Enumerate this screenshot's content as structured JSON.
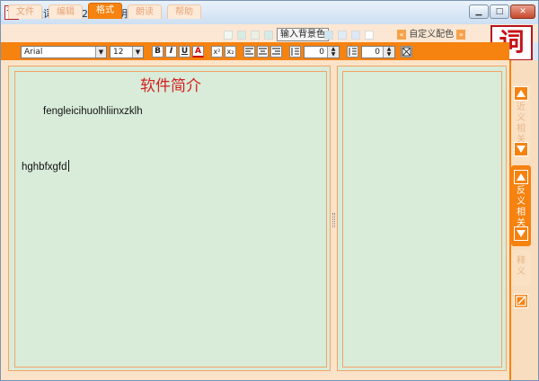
{
  "window": {
    "title": "分类词汇1422 - 清风明月版",
    "app_icon_glyph": "词"
  },
  "menu": {
    "tabs": [
      {
        "label": "文件"
      },
      {
        "label": "编辑"
      },
      {
        "label": "格式"
      },
      {
        "label": "朗读"
      },
      {
        "label": "帮助"
      }
    ],
    "active_tab": "格式",
    "bg_color_button": "输入背景色",
    "custom_color_label": "自定义配色"
  },
  "logo": {
    "glyph": "词"
  },
  "format_toolbar": {
    "font_name": "Arial",
    "font_size": "12",
    "bold": "B",
    "italic": "I",
    "underline": "U",
    "color": "A",
    "superscript": "x²",
    "subscript": "x₂",
    "line_spacing_value": "0",
    "paragraph_spacing_value": "0"
  },
  "editor": {
    "title": "软件简介",
    "line1": "fengleicihuolhliinxzklh",
    "line2": "hghbfxgfd"
  },
  "side_tabs": {
    "synonym": "近义相关",
    "antonym": "反义相关",
    "definition": "释义"
  },
  "colors": {
    "accent": "#f6820f",
    "panel_bg": "#d9ecd9",
    "title_red": "#d42020"
  }
}
